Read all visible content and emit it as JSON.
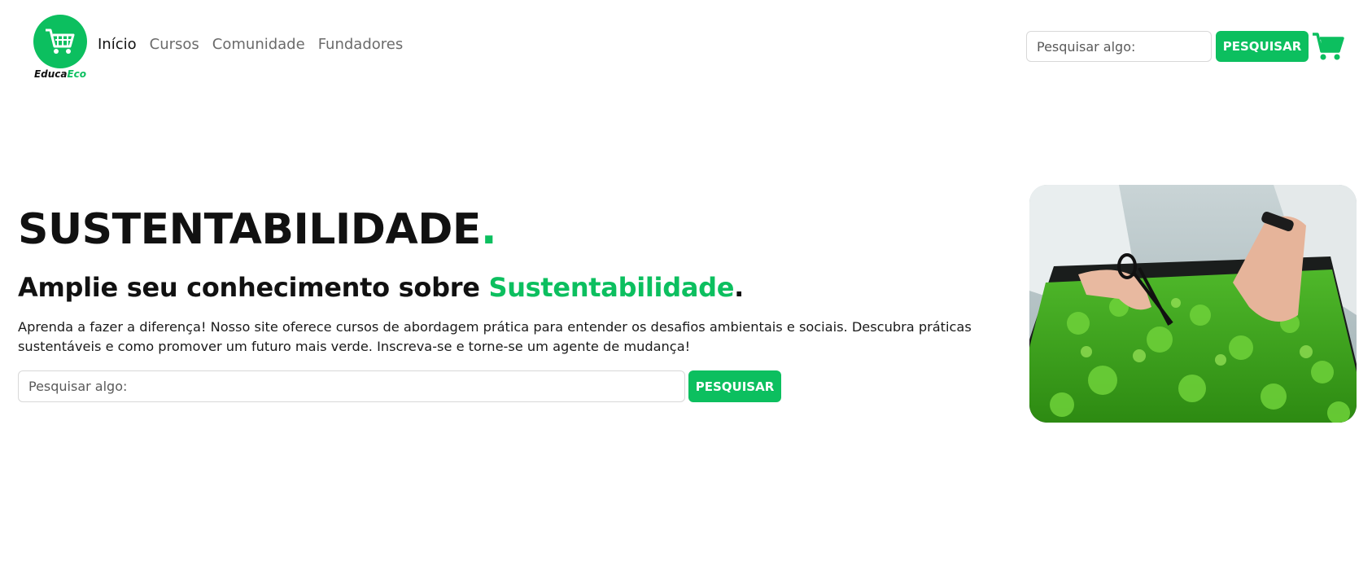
{
  "brand": {
    "name_part1": "Educa",
    "name_part2": "Eco",
    "accent_color": "#0cbf5f",
    "logo_icon": "shopping-cart-icon"
  },
  "nav": {
    "items": [
      {
        "label": "Início",
        "active": true
      },
      {
        "label": "Cursos",
        "active": false
      },
      {
        "label": "Comunidade",
        "active": false
      },
      {
        "label": "Fundadores",
        "active": false
      }
    ],
    "search_placeholder": "Pesquisar algo:",
    "search_button": "PESQUISAR",
    "cart_icon": "shopping-cart-icon"
  },
  "hero": {
    "title": "SUSTENTABILIDADE",
    "title_dot": ".",
    "subtitle_prefix": "Amplie seu conhecimento sobre ",
    "subtitle_accent": "Sustentabilidade",
    "subtitle_suffix": ".",
    "description": "Aprenda a fazer a diferença! Nosso site oferece cursos de abordagem prática para entender os desafios ambientais e sociais. Descubra práticas sustentáveis e como promover um futuro mais verde. Inscreva-se e torne-se um agente de mudança!",
    "search_placeholder": "Pesquisar algo:",
    "search_button": "PESQUISAR",
    "image": "photo-hands-cutting-microgreens"
  }
}
